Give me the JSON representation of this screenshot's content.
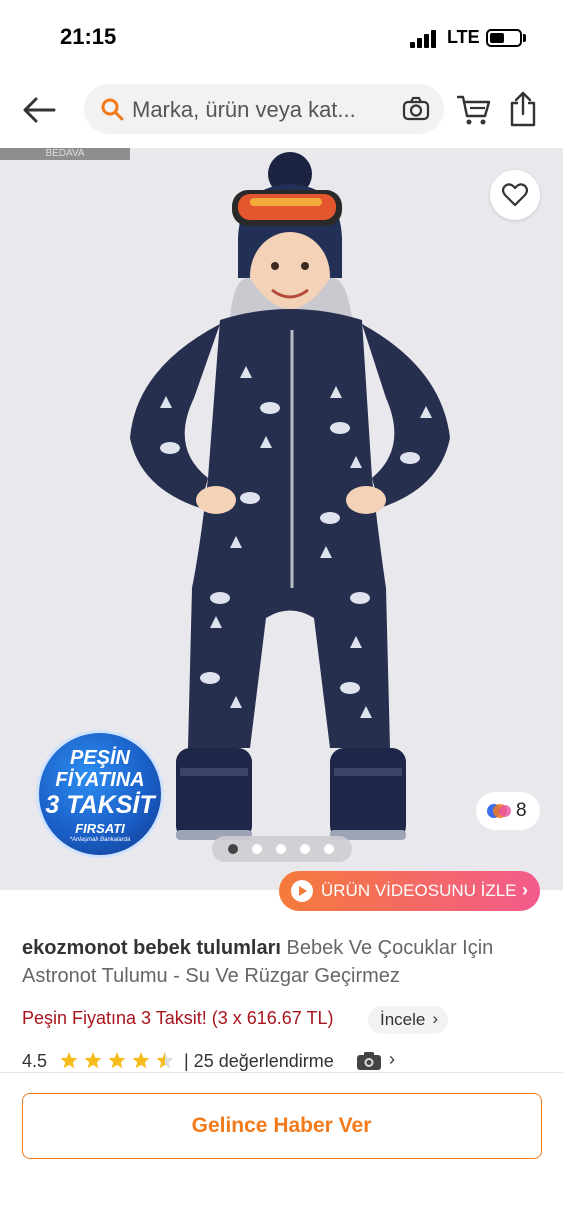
{
  "status_bar": {
    "time": "21:15",
    "network": "LTE"
  },
  "search": {
    "placeholder": "Marka, ürün veya kat..."
  },
  "hero": {
    "size_tag": "BEDAVA",
    "promo_badge": {
      "line1": "PEŞİN",
      "line2": "FİYATINA",
      "line3": "3 TAKSİT",
      "line4": "FIRSATI",
      "footnote": "*Anlaşmalı Bankalarda"
    },
    "color_count": "8",
    "carousel": {
      "total": 5,
      "active": 1
    },
    "video_button": "ÜRÜN VİDEOSUNU İZLE"
  },
  "product": {
    "brand": "ekozmonot bebek tulumları",
    "title": "Bebek Ve Çocuklar Için Astronot Tulumu - Su Ve Rüzgar Geçirmez",
    "installment": "Peşin Fiyatına 3 Taksit! (3 x 616.67 TL)",
    "incele_label": "İncele",
    "rating_value": "4.5",
    "rating_score": 4.5,
    "rating_link": "| 25 değerlendirme"
  },
  "bottom": {
    "notify_button": "Gelince Haber Ver"
  },
  "colors": {
    "accent": "#f27a1a",
    "installment": "#a8141e",
    "star": "#f8bd1c"
  }
}
